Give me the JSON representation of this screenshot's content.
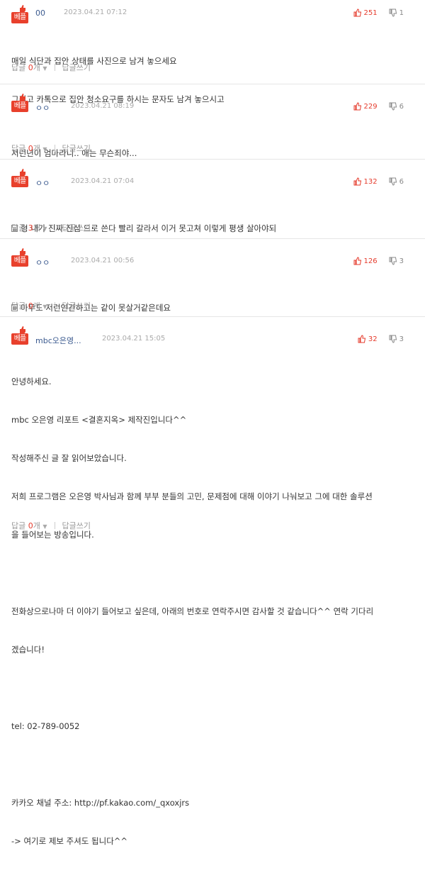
{
  "colors": {
    "accent": "#e53b2c",
    "badge": "#e8402c",
    "name": "#3b5a8f"
  },
  "badge_label": "베플",
  "reply_label": "답글",
  "reply_count_suffix": "개",
  "write_reply_label": "답글쓰기",
  "comments": [
    {
      "name": "00",
      "date": "2023.04.21 07:12",
      "up": "251",
      "down": "1",
      "lines": [
        "매일 식단과 집안 상태를 사진으로 남겨 놓으세요",
        "그리고 카톡으로 집안 청소요구를 하시는 문자도 남겨 놓으시고"
      ],
      "reply_count": "0"
    },
    {
      "name": "ㅇㅇ",
      "date": "2023.04.21 08:19",
      "up": "229",
      "down": "6",
      "lines": [
        "저런년이 엄마라니.. 애는 무슨죄야..."
      ],
      "reply_count": "0"
    },
    {
      "name": "ㅇㅇ",
      "date": "2023.04.21 07:04",
      "up": "132",
      "down": "6",
      "lines": [
        "형 내가 진짜 진심 으로 쓴다 빨리 갈라서 이거 못고쳐 이렇게 평생 살아야되"
      ],
      "reply_count": "3"
    },
    {
      "name": "ㅇㅇ",
      "date": "2023.04.21 00:56",
      "up": "126",
      "down": "3",
      "lines": [
        "아무도 저런인간하고는 같이 못살거같은데요"
      ],
      "reply_count": "0"
    },
    {
      "name": "mbc오은영...",
      "date": "2023.04.21 15:05",
      "up": "32",
      "down": "3",
      "lines": [
        "안녕하세요.",
        "mbc 오은영 리포트 <결혼지옥> 제작진입니다^^",
        "작성해주신 글 잘 읽어보았습니다.",
        "저희 프로그램은 오은영 박사님과 함께 부부 분들의 고민, 문제점에 대해 이야기 나눠보고 그에 대한 솔루션",
        "을 들어보는 방송입니다.",
        "",
        "전화상으로나마 더 이야기 들어보고 싶은데, 아래의 번호로 연락주시면 감사할 것 같습니다^^ 연락 기다리",
        "겠습니다!",
        "",
        "tel: 02-789-0052",
        "",
        "카카오 채널 주소: http://pf.kakao.com/_qxoxjrs",
        "-> 여기로 제보 주셔도 됩니다^^"
      ],
      "reply_count": "0"
    }
  ]
}
